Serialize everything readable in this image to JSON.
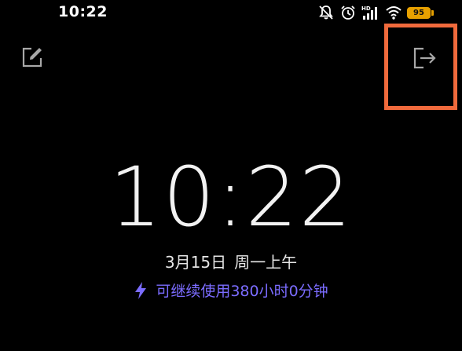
{
  "status_bar": {
    "time": "10:22",
    "battery_level": "95",
    "network_badge": "HD",
    "icons": [
      "mute-icon",
      "alarm-icon",
      "signal-icon",
      "wifi-icon",
      "battery-icon"
    ]
  },
  "toolbar": {
    "edit_icon": "edit-icon",
    "exit_icon": "exit-icon"
  },
  "clock": {
    "time": "10:22",
    "date": "3月15日",
    "weekday_period": "周一上午"
  },
  "battery_info": {
    "icon": "lightning-icon",
    "text": "可继续使用380小时0分钟"
  },
  "colors": {
    "background": "#000000",
    "accent": "#7b6cff",
    "highlight": "#f06a3c",
    "battery": "#e8a100"
  }
}
